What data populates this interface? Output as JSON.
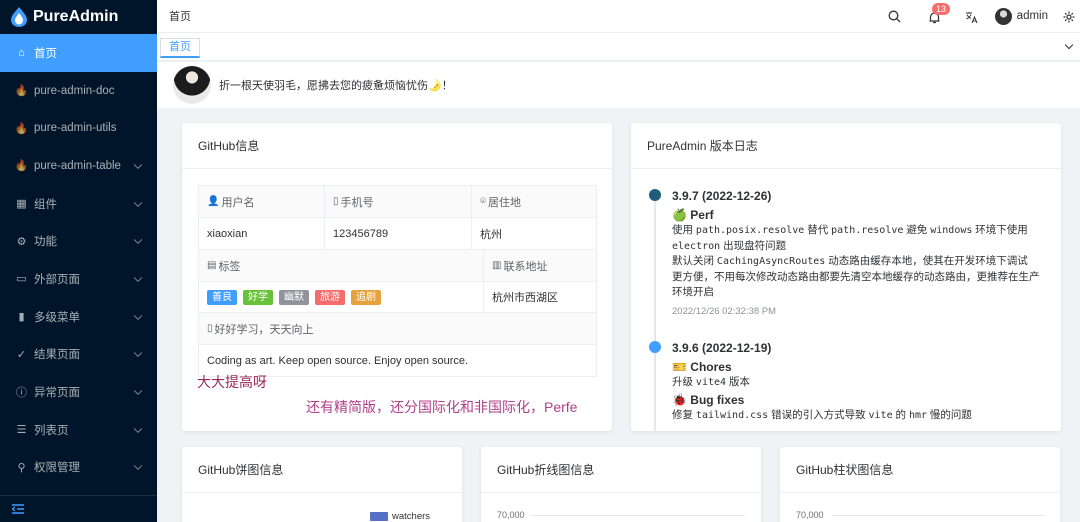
{
  "brand": {
    "name": "PureAdmin"
  },
  "sidebar": {
    "items": [
      {
        "label": "首页",
        "icon": "home-icon",
        "active": true,
        "chevron": false
      },
      {
        "label": "pure-admin-doc",
        "icon": "fire-icon",
        "active": false,
        "chevron": false
      },
      {
        "label": "pure-admin-utils",
        "icon": "fire-icon",
        "active": false,
        "chevron": false
      },
      {
        "label": "pure-admin-table",
        "icon": "fire-icon",
        "active": false,
        "chevron": true
      },
      {
        "label": "组件",
        "icon": "grid-icon",
        "active": false,
        "chevron": true
      },
      {
        "label": "功能",
        "icon": "gear-icon",
        "active": false,
        "chevron": true
      },
      {
        "label": "外部页面",
        "icon": "monitor-icon",
        "active": false,
        "chevron": true
      },
      {
        "label": "多级菜单",
        "icon": "bar-chart-icon",
        "active": false,
        "chevron": true
      },
      {
        "label": "结果页面",
        "icon": "check-circle-icon",
        "active": false,
        "chevron": true
      },
      {
        "label": "异常页面",
        "icon": "info-circle-icon",
        "active": false,
        "chevron": true
      },
      {
        "label": "列表页",
        "icon": "list-icon",
        "active": false,
        "chevron": true
      },
      {
        "label": "权限管理",
        "icon": "key-icon",
        "active": false,
        "chevron": true
      }
    ],
    "collapse_icon": "collapse-icon"
  },
  "header": {
    "breadcrumb": "首页",
    "notification_count": "13",
    "user_name": "admin"
  },
  "tabs": [
    {
      "label": "首页"
    }
  ],
  "welcome": {
    "text": "折一根天使羽毛，愿拂去您的疲惫烦恼忧伤🌛！"
  },
  "github_info": {
    "title": "GitHub信息",
    "username_label": "用户名",
    "phone_label": "手机号",
    "residence_label": "居住地",
    "username": "xiaoxian",
    "phone": "123456789",
    "residence": "杭州",
    "tags_label": "标签",
    "address_label": "联系地址",
    "tags": [
      {
        "text": "善良",
        "color": "#409eff"
      },
      {
        "text": "好学",
        "color": "#67c23a"
      },
      {
        "text": "幽默",
        "color": "#909399"
      },
      {
        "text": "旅游",
        "color": "#f56c6c"
      },
      {
        "text": "追剧",
        "color": "#e6a23c"
      }
    ],
    "address": "杭州市西湖区",
    "motto_label": "好好学习，天天向上",
    "motto": "Coding as art. Keep open source. Enjoy open source.",
    "handwrite_1": "大大提高呀",
    "handwrite_2": "还有精简版，还分国际化和非国际化，Perfe"
  },
  "changelog": {
    "title": "PureAdmin 版本日志",
    "entries": [
      {
        "version": "3.9.7 (2022-12-26)",
        "dot_color": "#1f5e7a",
        "perf_title": "🍏 Perf",
        "perf_1a": "使用 ",
        "perf_1b": "path.posix.resolve",
        "perf_1c": " 替代 ",
        "perf_1d": "path.resolve",
        "perf_1e": " 避免 ",
        "perf_1f": "windows",
        "perf_1g": " 环境下使用",
        "perf_2a": "electron",
        "perf_2b": " 出现盘符问题",
        "perf_3a": "默认关闭 ",
        "perf_3b": "CachingAsyncRoutes",
        "perf_3c": " 动态路由缓存本地，使其在开发环境下调试",
        "perf_4": "更方便，不用每次修改动态路由都要先清空本地缓存的动态路由，更推荐在生产",
        "perf_5": "环境开启",
        "time": "2022/12/26 02:32:38 PM"
      },
      {
        "version": "3.9.6 (2022-12-19)",
        "dot_color": "#409eff",
        "chores_title": "🎫 Chores",
        "chores_1a": "升级 ",
        "chores_1b": "vite4",
        "chores_1c": " 版本",
        "bug_title": "🐞 Bug fixes",
        "bug_1a": "修复 ",
        "bug_1b": "tailwind.css",
        "bug_1c": " 错误的引入方式导致 ",
        "bug_1d": "vite",
        "bug_1e": " 的 ",
        "bug_1f": "hmr",
        "bug_1g": " 慢的问题"
      }
    ]
  },
  "pie_card": {
    "title": "GitHub饼图信息",
    "legend": "watchers",
    "legend_color": "#5470c6"
  },
  "line_card": {
    "title": "GitHub折线图信息",
    "y_top": "70,000"
  },
  "bar_card": {
    "title": "GitHub柱状图信息",
    "y_top": "70,000"
  }
}
